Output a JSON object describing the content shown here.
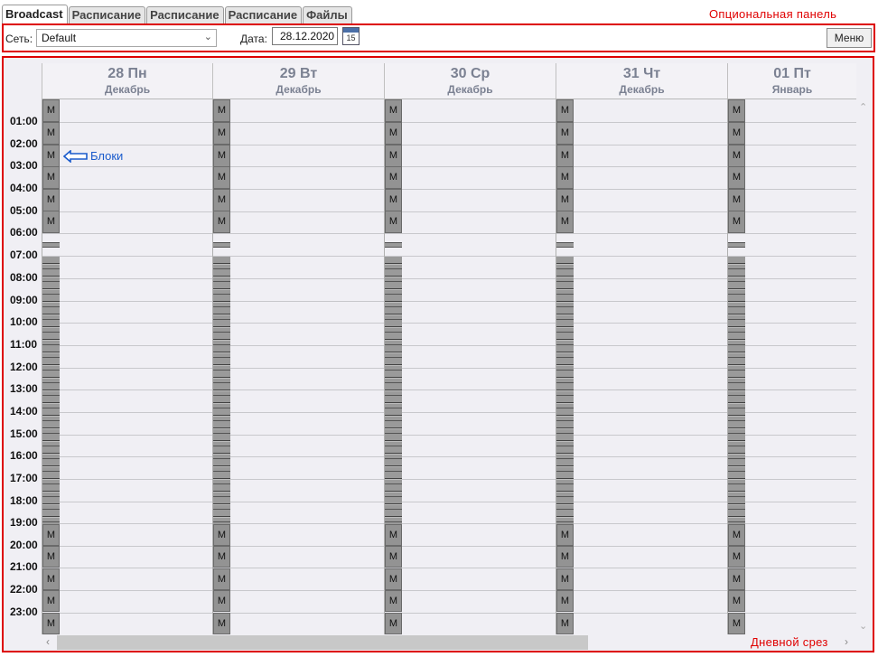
{
  "tabs": [
    {
      "label": "Broadcast",
      "active": true
    },
    {
      "label": "Расписание"
    },
    {
      "label": "Расписание"
    },
    {
      "label": "Расписание"
    },
    {
      "label": "Файлы"
    }
  ],
  "optional_panel_label": "Опциональная панель",
  "toolbar": {
    "network_label": "Сеть:",
    "network_value": "Default",
    "date_label": "Дата:",
    "date_value": "28.12.2020",
    "calendar_day": "15",
    "menu_label": "Меню"
  },
  "days": [
    {
      "day": "28 Пн",
      "month": "Декабрь"
    },
    {
      "day": "29 Вт",
      "month": "Декабрь"
    },
    {
      "day": "30 Ср",
      "month": "Декабрь"
    },
    {
      "day": "31 Чт",
      "month": "Декабрь"
    },
    {
      "day": "01 Пт",
      "month": "Январь"
    }
  ],
  "hours": [
    "01:00",
    "02:00",
    "03:00",
    "04:00",
    "05:00",
    "06:00",
    "07:00",
    "08:00",
    "09:00",
    "10:00",
    "11:00",
    "12:00",
    "13:00",
    "14:00",
    "15:00",
    "16:00",
    "17:00",
    "18:00",
    "19:00",
    "20:00",
    "21:00",
    "22:00",
    "23:00"
  ],
  "block_label": "M",
  "blocks_annotation": "Блоки",
  "day_slice_label": "Дневной срез",
  "colors": {
    "annotation_red": "#dd0000",
    "annotation_blue": "#1a5bcc",
    "block_gray": "#939393"
  }
}
